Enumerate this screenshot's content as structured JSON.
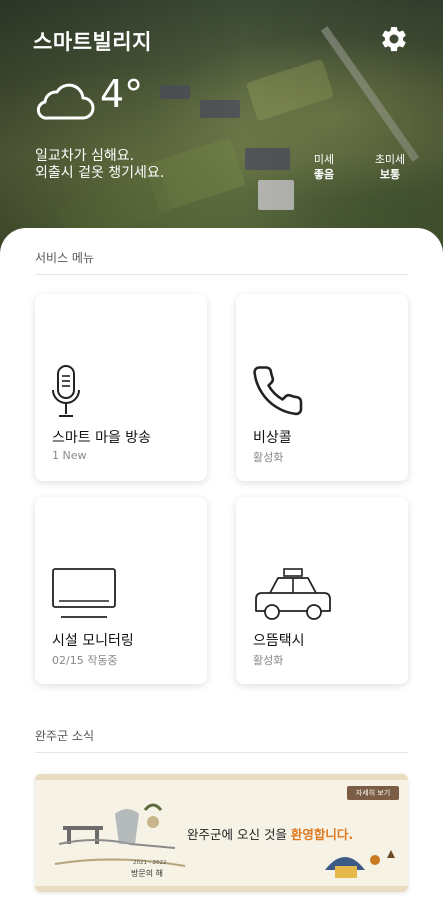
{
  "app": {
    "logo_text": "스마트빌리지"
  },
  "header": {
    "settings_icon": "gear-icon"
  },
  "weather": {
    "icon": "cloud-icon",
    "temperature": "4°",
    "message_line1": "일교차가 심해요.",
    "message_line2": "외출시 겉옷 챙기세요.",
    "fine_dust_label": "미세",
    "fine_dust_value": "좋음",
    "ultrafine_dust_label": "초미세",
    "ultrafine_dust_value": "보통"
  },
  "services": {
    "title": "서비스 메뉴",
    "items": [
      {
        "label": "스마트 마을 방송",
        "sub": "1 New",
        "icon": "microphone-icon"
      },
      {
        "label": "비상콜",
        "sub": "활성화",
        "icon": "phone-icon"
      },
      {
        "label": "시설 모니터링",
        "sub": "02/15 작동중",
        "icon": "monitor-icon"
      },
      {
        "label": "으뜸택시",
        "sub": "활성화",
        "icon": "taxi-icon"
      }
    ]
  },
  "news": {
    "title": "완주군 소식",
    "banner": {
      "more_label": "자세히 보기",
      "welcome_prefix": "완주군에 오신 것을 ",
      "welcome_highlight": "환영합니다.",
      "year_range": "2021 - 2022",
      "theme": "방문의 해"
    }
  },
  "colors": {
    "accent": "#e07a1f",
    "banner_bg": "#f6f2e6"
  }
}
